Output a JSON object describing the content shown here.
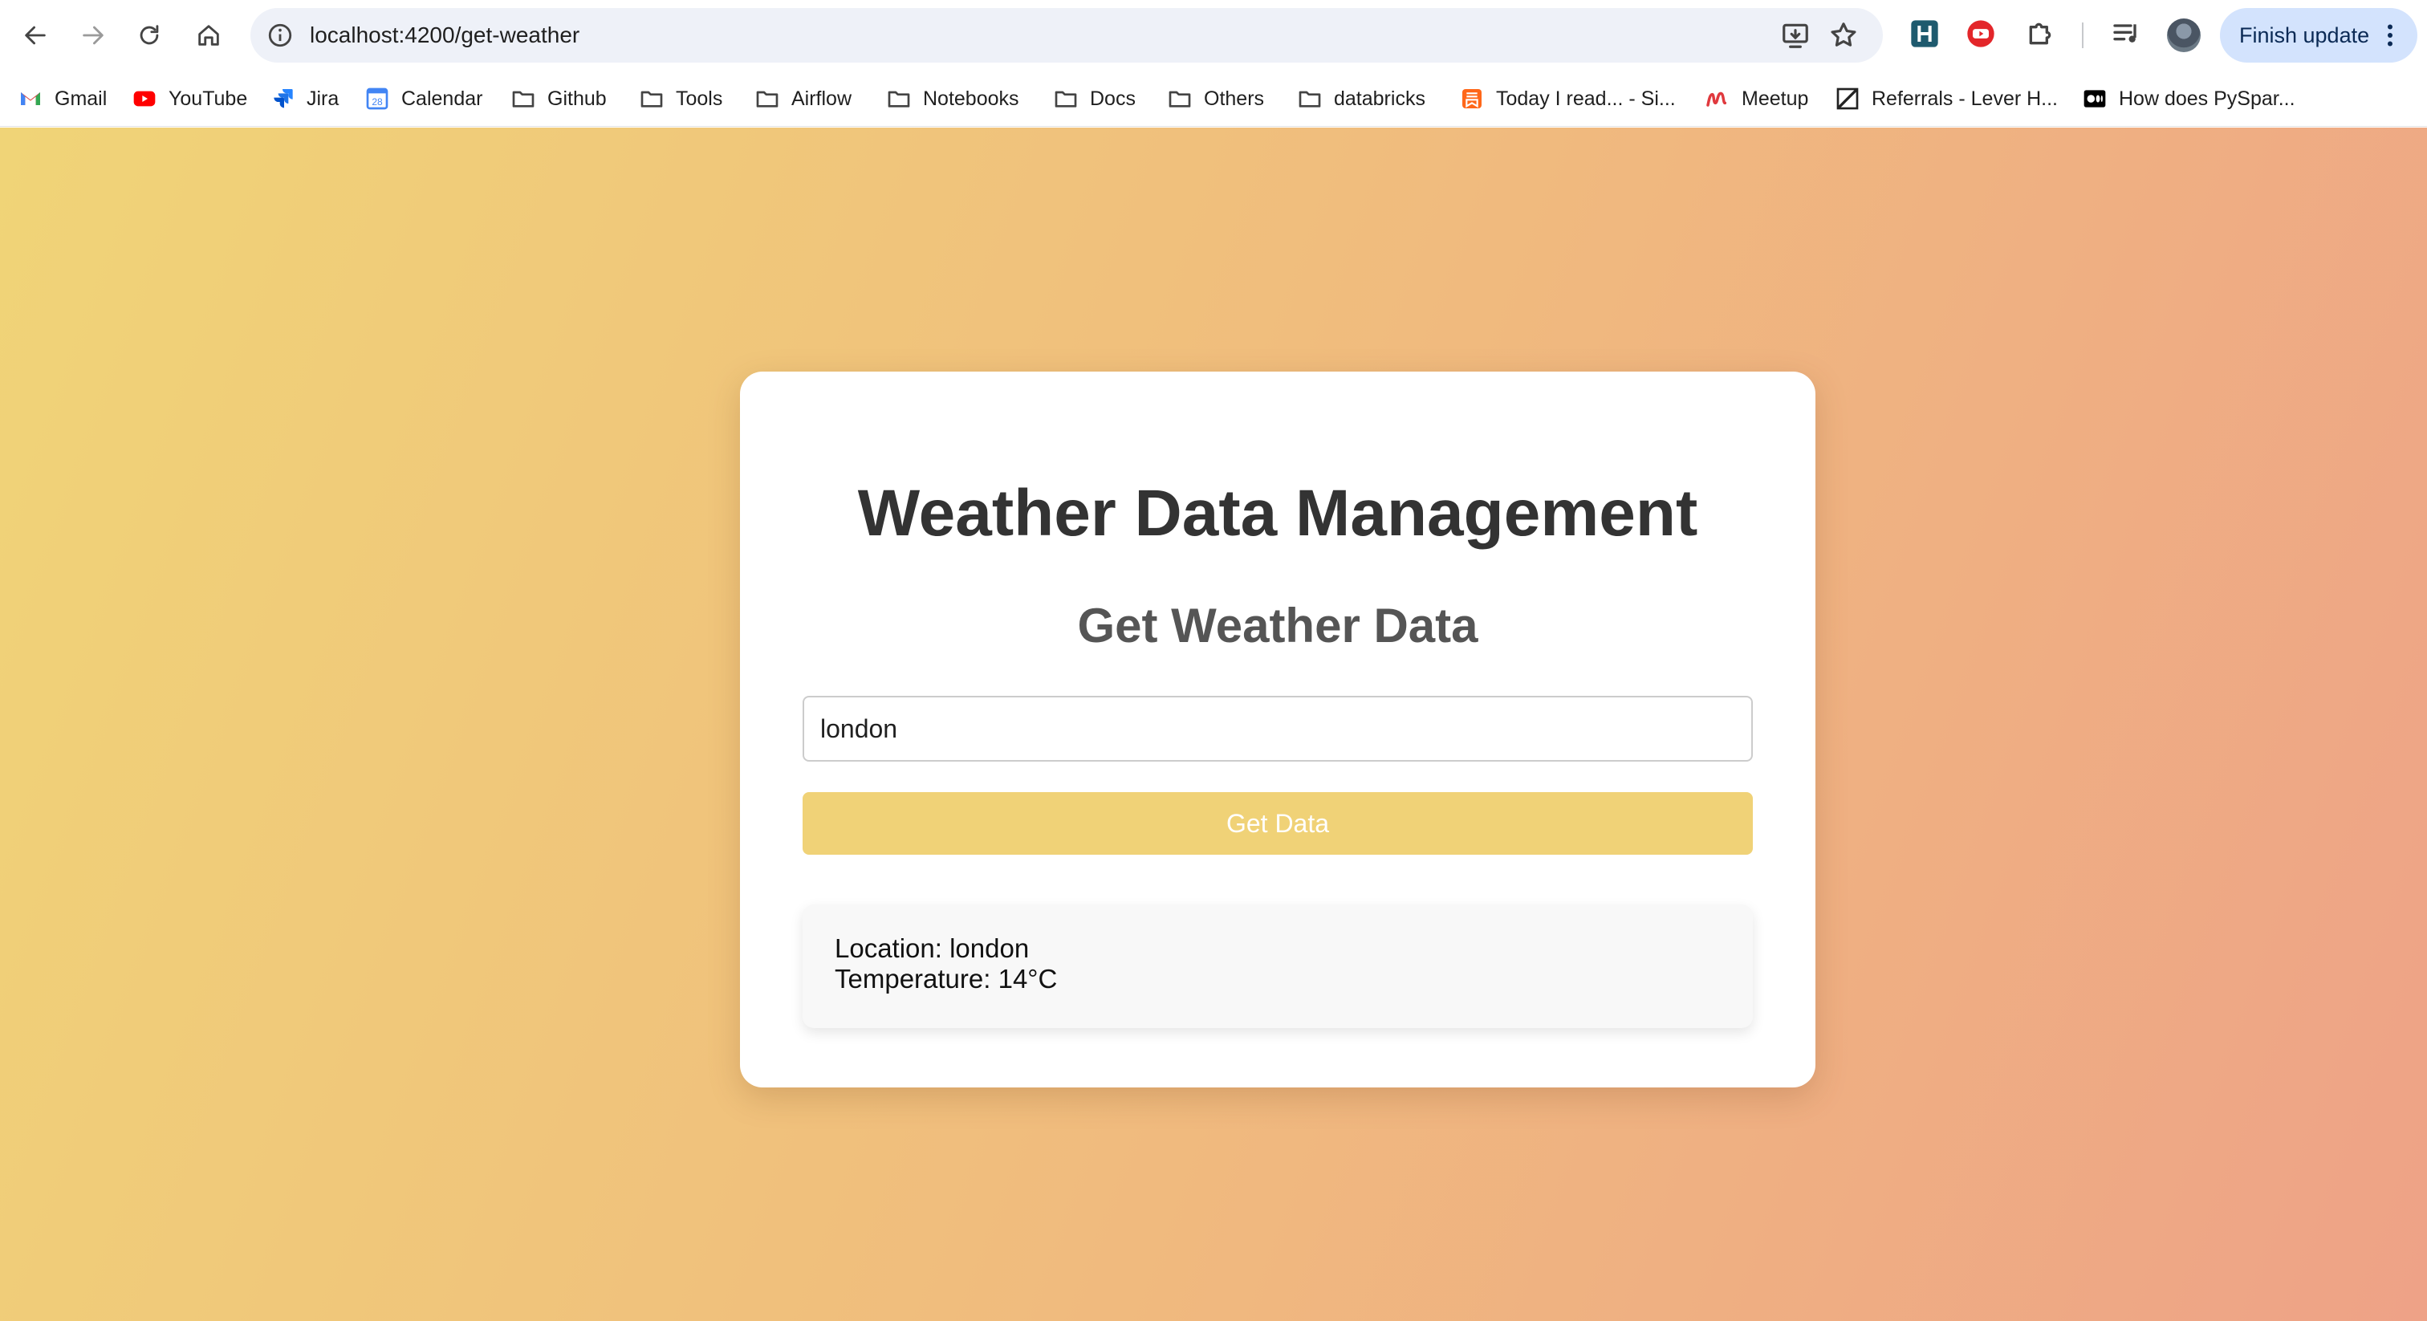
{
  "browser": {
    "url": "localhost:4200/get-weather",
    "finish_update_label": "Finish update",
    "icons": {
      "back": "arrow-left-icon",
      "forward": "arrow-right-icon",
      "reload": "reload-icon",
      "home": "home-icon",
      "site_info": "info-icon",
      "install": "install-app-icon",
      "bookmark": "star-icon",
      "extension_1": "h-extension-icon",
      "extension_2": "youtube-extension-icon",
      "extensions": "puzzle-icon",
      "media": "media-queue-icon",
      "profile": "avatar",
      "menu": "kebab-menu-icon"
    }
  },
  "bookmarks": [
    {
      "label": "Gmail",
      "icon": "gmail-icon"
    },
    {
      "label": "YouTube",
      "icon": "youtube-icon"
    },
    {
      "label": "Jira",
      "icon": "jira-icon"
    },
    {
      "label": "Calendar",
      "icon": "calendar-icon"
    },
    {
      "label": "Github",
      "icon": "folder-icon"
    },
    {
      "label": "Tools",
      "icon": "folder-icon"
    },
    {
      "label": "Airflow",
      "icon": "folder-icon"
    },
    {
      "label": "Notebooks",
      "icon": "folder-icon"
    },
    {
      "label": "Docs",
      "icon": "folder-icon"
    },
    {
      "label": "Others",
      "icon": "folder-icon"
    },
    {
      "label": "databricks",
      "icon": "folder-icon"
    },
    {
      "label": "Today I read... - Si...",
      "icon": "substack-icon"
    },
    {
      "label": "Meetup",
      "icon": "meetup-icon"
    },
    {
      "label": "Referrals - Lever H...",
      "icon": "lever-icon"
    },
    {
      "label": "How does PySpar...",
      "icon": "medium-icon"
    }
  ],
  "calendar_badge": "28",
  "app": {
    "title": "Weather Data Management",
    "subtitle": "Get Weather Data",
    "location_input_value": "london",
    "get_data_label": "Get Data",
    "result": {
      "location_line": "Location: london",
      "temperature_line": "Temperature: 14°C"
    }
  },
  "colors": {
    "gradient_start": "#f0d477",
    "gradient_end": "#eea287",
    "button": "#f0d277",
    "heading": "#333333"
  }
}
